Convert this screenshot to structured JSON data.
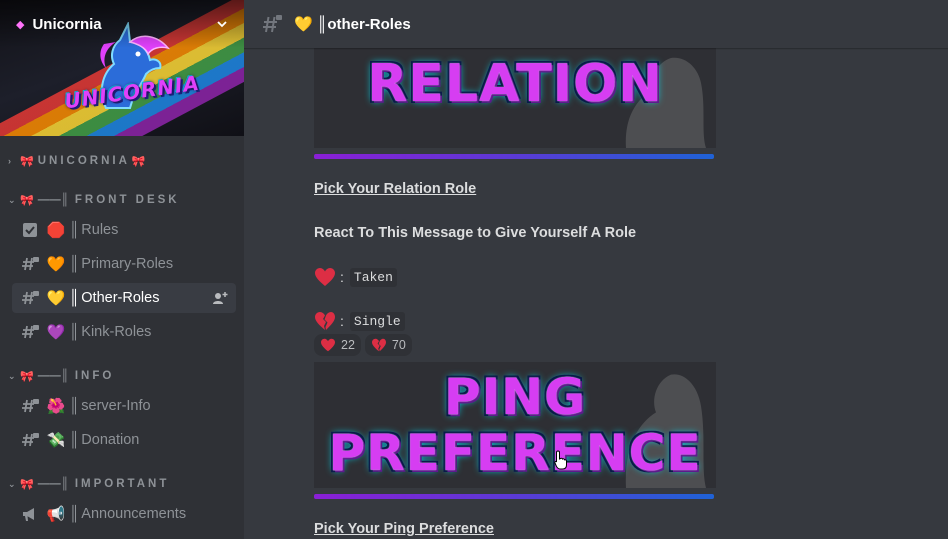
{
  "server": {
    "name": "Unicornia",
    "banner_text": "UNICORNIA"
  },
  "categories": [
    {
      "label": "UNICORNIA"
    },
    {
      "label": "FRONT DESK"
    },
    {
      "label": "INFO"
    },
    {
      "label": "IMPORTANT"
    }
  ],
  "bow_emoji": "🎀",
  "category_prefix": "——║",
  "channels": [
    {
      "name": "Rules",
      "emoji": "🛑",
      "icon": "rules-checkbox-icon"
    },
    {
      "name": "Primary-Roles",
      "emoji": "🧡",
      "icon": "text-channel-lock-icon"
    },
    {
      "name": "Other-Roles",
      "emoji": "💛",
      "icon": "text-channel-lock-icon"
    },
    {
      "name": "Kink-Roles",
      "emoji": "💜",
      "icon": "text-channel-lock-icon"
    },
    {
      "name": "server-Info",
      "emoji": "🌺",
      "icon": "text-channel-lock-icon"
    },
    {
      "name": "Donation",
      "emoji": "💸",
      "icon": "text-channel-lock-icon"
    },
    {
      "name": "Announcements",
      "emoji": "📢",
      "icon": "announcement-icon"
    }
  ],
  "channel_sep": "║",
  "header": {
    "emoji": "💛",
    "title": "║other-Roles"
  },
  "message": {
    "banner1_text": "RELATION",
    "heading1": "Pick Your Relation Role",
    "instruction": "React To This Message to Give Yourself A Role",
    "option1_code": "Taken",
    "option2_code": "Single",
    "colon": ":",
    "reactions": [
      {
        "emoji": "red-heart",
        "count": "22"
      },
      {
        "emoji": "broken-heart",
        "count": "70"
      }
    ],
    "banner2_line1": "PING",
    "banner2_line2": "PREFERENCE",
    "heading2": "Pick Your Ping Preference"
  },
  "colors": {
    "sidebar_bg": "#2f3136",
    "main_bg": "#36393f",
    "accent_purple": "#d63df2",
    "heart_red": "#dd2e44",
    "divider_start": "#8a1fd6",
    "divider_end": "#1f62d6"
  }
}
